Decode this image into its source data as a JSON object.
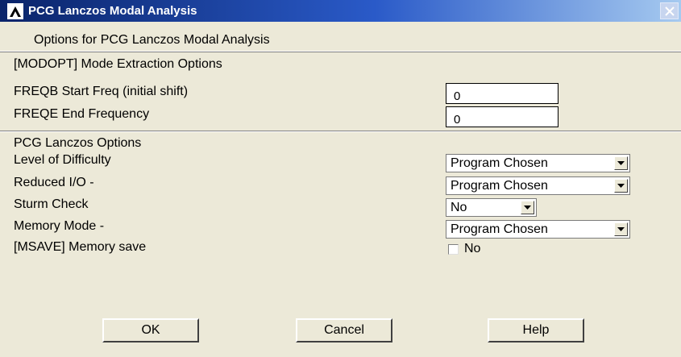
{
  "window": {
    "title": "PCG Lanczos Modal Analysis",
    "logo_icon": "ansys-lambda-logo",
    "close_icon": "close-x-icon"
  },
  "dialog": {
    "subtitle": "Options for PCG Lanczos Modal Analysis"
  },
  "modopt": {
    "section_label": "[MODOPT]  Mode Extraction Options",
    "freqb_label": "FREQB Start Freq (initial shift)",
    "freqb_value": "0",
    "freqe_label": "FREQE End Frequency",
    "freqe_value": "0"
  },
  "pcg": {
    "section_label": "PCG Lanczos Options",
    "difficulty_label": "Level of Difficulty",
    "difficulty_value": "Program Chosen",
    "reduced_io_label": "Reduced I/O -",
    "reduced_io_value": "Program Chosen",
    "sturm_label": "Sturm Check",
    "sturm_value": "No",
    "memory_mode_label": "Memory Mode -",
    "memory_mode_value": "Program Chosen",
    "msave_label": "[MSAVE]  Memory save",
    "msave_value": "No",
    "msave_checked": false
  },
  "buttons": {
    "ok": "OK",
    "cancel": "Cancel",
    "help": "Help"
  }
}
